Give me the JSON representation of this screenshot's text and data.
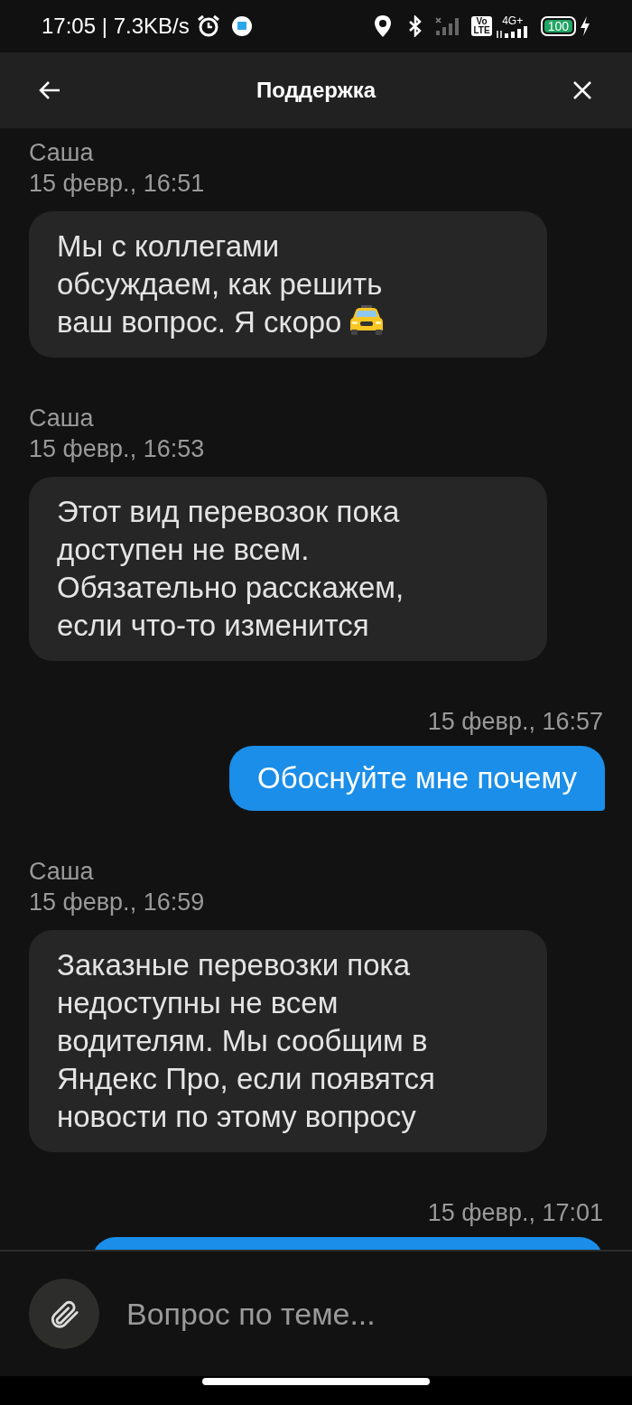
{
  "status_bar": {
    "time": "17:05 | 7.3KB/s",
    "volte": [
      "Vo",
      "LTE"
    ],
    "network": "4G+",
    "battery": "100"
  },
  "header": {
    "title": "Поддержка"
  },
  "messages": [
    {
      "kind": "incoming",
      "author": "Саша",
      "time": "15 февр., 16:51",
      "text": "Мы с коллегами\nобсуждаем, как решить\nваш вопрос. Я скоро",
      "icon": true
    },
    {
      "kind": "incoming",
      "author": "Саша",
      "time": "15 февр., 16:53",
      "text": "Этот вид перевозок пока\nдоступен не всем.\nОбязательно расскажем,\nесли что-то изменится",
      "icon": false
    },
    {
      "kind": "outgoing",
      "time": "15 февр., 16:57",
      "text": "Обоснуйте мне почему"
    },
    {
      "kind": "incoming",
      "author": "Саша",
      "time": "15 февр., 16:59",
      "text": "Заказные перевозки пока\nнедоступны не всем\nводителям. Мы сообщим в\nЯндекс Про, если появятся\nновости по этому вопросу",
      "icon": false
    },
    {
      "kind": "outgoing",
      "time": "15 февр., 17:01"
    }
  ],
  "composer": {
    "placeholder": "Вопрос по теме..."
  }
}
